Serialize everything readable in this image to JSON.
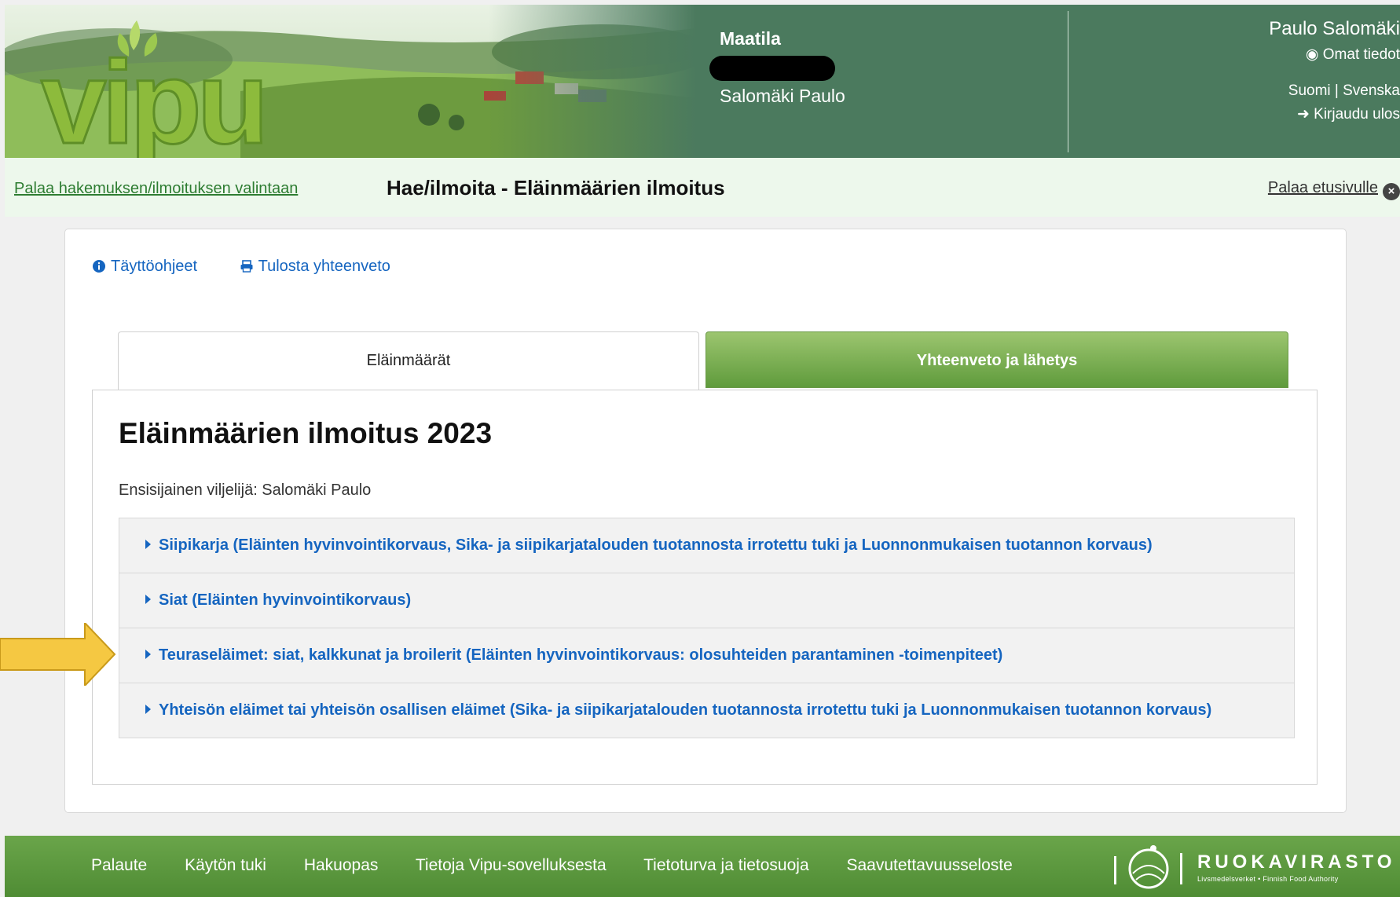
{
  "header": {
    "logo_text": "vipu",
    "farm_title": "Maatila",
    "farm_owner": "Salomäki Paulo",
    "user_name": "Paulo Salomäki",
    "own_info": "Omat tiedot",
    "languages": "Suomi | Svenska",
    "logout": "Kirjaudu ulos"
  },
  "subheader": {
    "back_link": "Palaa hakemuksen/ilmoituksen valintaan",
    "title": "Hae/ilmoita - Eläinmäärien ilmoitus",
    "home_link": "Palaa etusivulle"
  },
  "toolbar": {
    "instructions": "Täyttöohjeet",
    "print": "Tulosta yhteenveto"
  },
  "tabs": [
    {
      "label": "Eläinmäärät",
      "active": true
    },
    {
      "label": "Yhteenveto ja lähetys",
      "active": false
    }
  ],
  "main": {
    "heading": "Eläinmäärien ilmoitus 2023",
    "primary_farmer": "Ensisijainen viljelijä: Salomäki Paulo",
    "sections": [
      {
        "label": "Siipikarja (Eläinten hyvinvointikorvaus, Sika- ja siipikarjatalouden tuotannosta irrotettu tuki ja Luonnonmukaisen tuotannon korvaus)"
      },
      {
        "label": "Siat (Eläinten hyvinvointikorvaus)"
      },
      {
        "label": "Teuraseläimet: siat, kalkkunat ja broilerit (Eläinten hyvinvointikorvaus: olosuhteiden parantaminen -toimenpiteet)"
      },
      {
        "label": "Yhteisön eläimet tai yhteisön osallisen eläimet (Sika- ja siipikarjatalouden tuotannosta irrotettu tuki ja Luonnonmukaisen tuotannon korvaus)"
      }
    ]
  },
  "footer": {
    "links": [
      "Palaute",
      "Käytön tuki",
      "Hakuopas",
      "Tietoja Vipu-sovelluksesta",
      "Tietoturva ja tietosuoja",
      "Saavutettavuusseloste"
    ],
    "brand": "RUOKAVIRASTO",
    "brand_sub": "Livsmedelsverket • Finnish Food Authority"
  },
  "colors": {
    "header_green": "#4b7a5e",
    "subheader_bg": "#edf8ec",
    "link_blue": "#1565c0",
    "footer_green": "#5f9b3c",
    "arrow_yellow": "#f5c842"
  }
}
